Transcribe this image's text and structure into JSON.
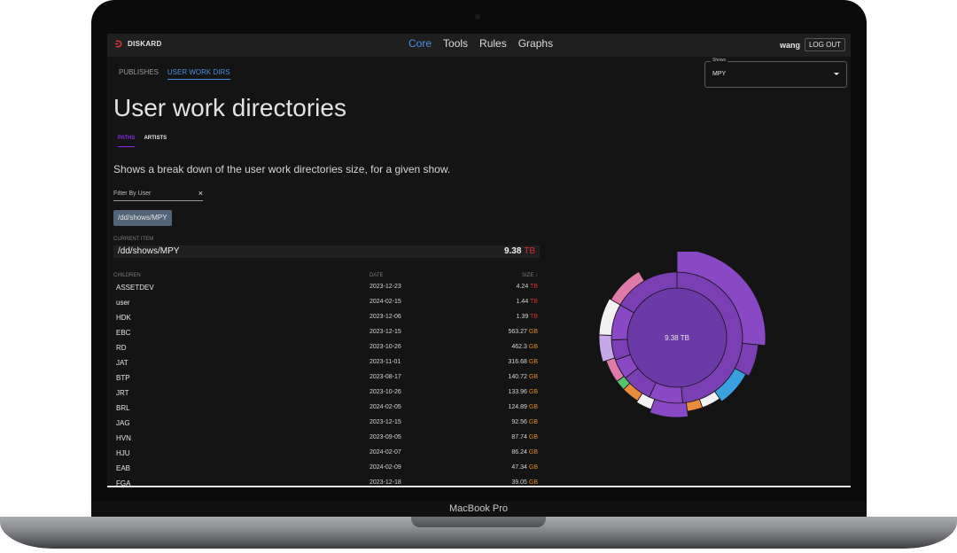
{
  "laptop": {
    "model_label": "MacBook Pro"
  },
  "app": {
    "brand": "DISKARD",
    "nav": [
      "Core",
      "Tools",
      "Rules",
      "Graphs"
    ],
    "active_nav": "Core",
    "user_name": "wang",
    "logout_label": "LOG OUT"
  },
  "subtabs": [
    "PUBLISHES",
    "USER WORK DIRS"
  ],
  "active_subtab": "USER WORK DIRS",
  "shows_select": {
    "label": "Shows",
    "value": "MPY"
  },
  "page": {
    "title": "User work directories",
    "tabs": [
      "PATHS",
      "ARTISTS"
    ],
    "active_tab": "PATHS",
    "description": "Shows a break down of the user work directories size, for a given show."
  },
  "filter": {
    "placeholder": "Filter By User",
    "clear_label": "×"
  },
  "path_chip": "/dd/shows/MPY",
  "current_item": {
    "label": "CURRENT ITEM",
    "path": "/dd/shows/MPY",
    "size": "9.38",
    "unit": "TB"
  },
  "table": {
    "headers": {
      "children": "CHILDREN",
      "date": "DATE",
      "size": "SIZE ↓"
    },
    "rows": [
      {
        "name": "ASSETDEV",
        "date": "2023-12-23",
        "size": "4.24",
        "unit": "TB"
      },
      {
        "name": "user",
        "date": "2024-02-15",
        "size": "1.44",
        "unit": "TB"
      },
      {
        "name": "HDK",
        "date": "2023-12-06",
        "size": "1.39",
        "unit": "TB"
      },
      {
        "name": "EBC",
        "date": "2023-12-15",
        "size": "563.27",
        "unit": "GB"
      },
      {
        "name": "RD",
        "date": "2023-10-26",
        "size": "462.3",
        "unit": "GB"
      },
      {
        "name": "JAT",
        "date": "2023-11-01",
        "size": "316.68",
        "unit": "GB"
      },
      {
        "name": "BTP",
        "date": "2023-08-17",
        "size": "140.72",
        "unit": "GB"
      },
      {
        "name": "JRT",
        "date": "2023-10-26",
        "size": "133.96",
        "unit": "GB"
      },
      {
        "name": "BRL",
        "date": "2024-02-05",
        "size": "124.89",
        "unit": "GB"
      },
      {
        "name": "JAG",
        "date": "2023-12-15",
        "size": "92.56",
        "unit": "GB"
      },
      {
        "name": "HVN",
        "date": "2023-09-05",
        "size": "87.74",
        "unit": "GB"
      },
      {
        "name": "HJU",
        "date": "2024-02-07",
        "size": "86.24",
        "unit": "GB"
      },
      {
        "name": "EAB",
        "date": "2024-02-09",
        "size": "47.34",
        "unit": "GB"
      },
      {
        "name": "FGA",
        "date": "2023-12-18",
        "size": "39.05",
        "unit": "GB"
      }
    ]
  },
  "sunburst": {
    "center_label": "9.38 TB",
    "colors": {
      "center": "#6a3aa6",
      "ring": "#7b3fb4",
      "outer": "#8a49c4",
      "blue": "#3aa0e0",
      "orange": "#e98b3a",
      "green": "#56c46a",
      "pink": "#e07aa8",
      "white": "#f2f2f2",
      "edge": "#c7a8e6"
    }
  }
}
